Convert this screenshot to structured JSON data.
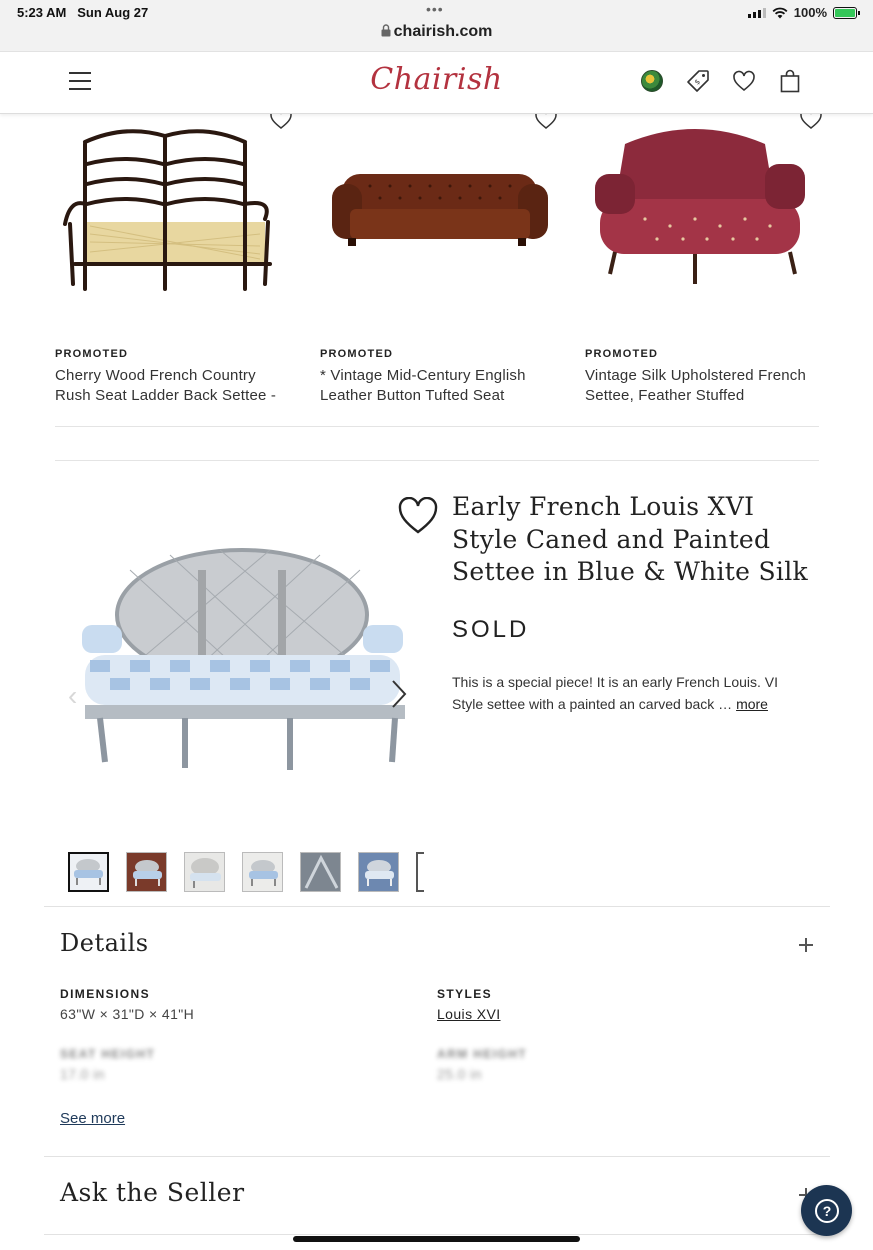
{
  "status_bar": {
    "time": "5:23 AM",
    "date": "Sun Aug 27",
    "url": "chairish.com",
    "battery": "100%"
  },
  "header": {
    "logo": "Chairish"
  },
  "promoted": [
    {
      "tag": "PROMOTED",
      "title": "Cherry Wood French Country Rush Seat Ladder Back Settee -"
    },
    {
      "tag": "PROMOTED",
      "title": "* Vintage Mid-Century English Leather Button Tufted Seat"
    },
    {
      "tag": "PROMOTED",
      "title": "Vintage Silk Upholstered French Settee, Feather Stuffed"
    }
  ],
  "product": {
    "title": "Early French Louis XVI Style Caned and Painted Settee in Blue & White Silk",
    "status": "SOLD",
    "description": "This is a special piece! It is an early French Louis. VI Style settee with a painted an carved back …",
    "more_label": "more"
  },
  "details": {
    "heading": "Details",
    "dimensions_label": "DIMENSIONS",
    "dimensions_value": "63\"W × 31\"D × 41\"H",
    "styles_label": "STYLES",
    "styles_value": "Louis XVI",
    "seat_height_label": "SEAT HEIGHT",
    "seat_height_value": "17.0 in",
    "arm_height_label": "ARM HEIGHT",
    "arm_height_value": "25.0 in",
    "see_more": "See more"
  },
  "ask_seller": {
    "heading": "Ask the Seller"
  },
  "help": {
    "icon_text": "?"
  },
  "colors": {
    "brand": "#b3323f",
    "help_button": "#1c3552"
  }
}
